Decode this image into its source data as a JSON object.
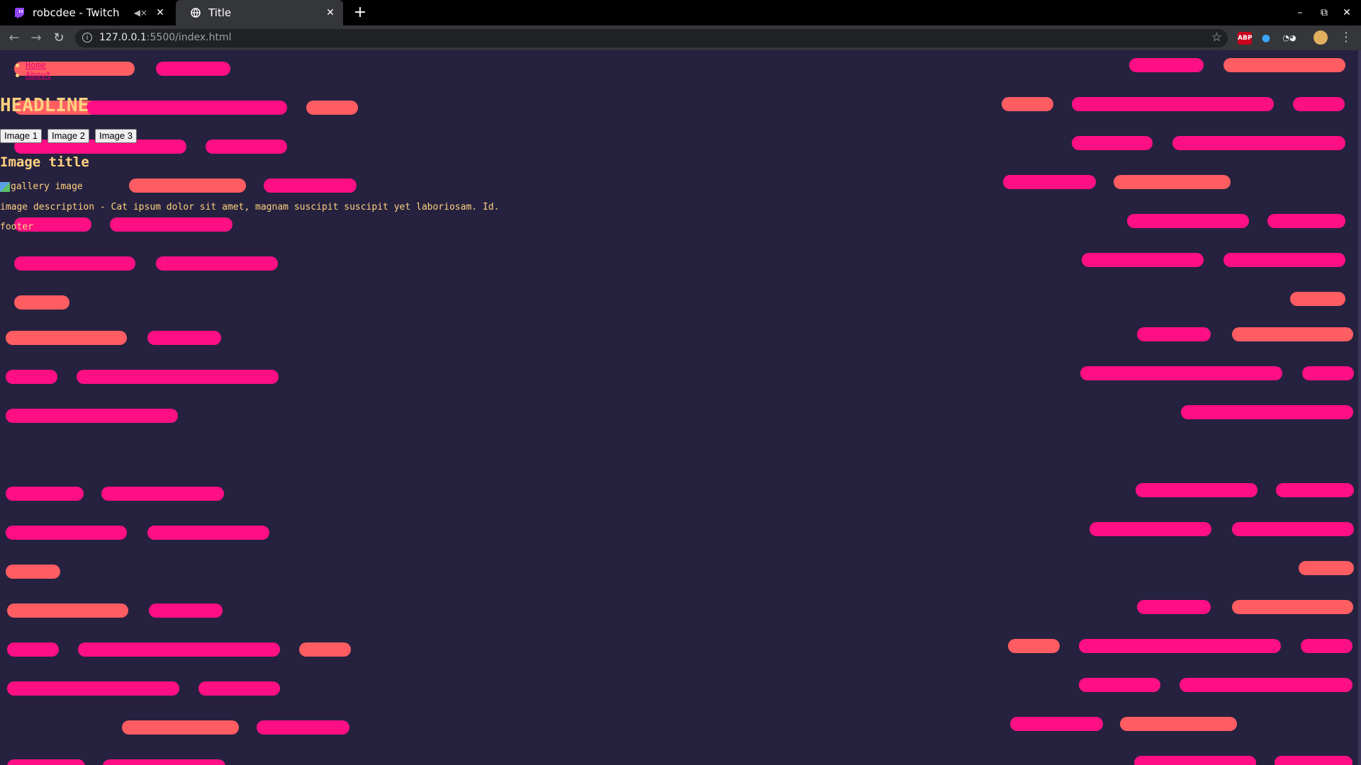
{
  "browser": {
    "tabs": [
      {
        "title": "robcdee - Twitch",
        "active": false,
        "favicon": "twitch-icon",
        "audio": "muted-speaker-icon"
      },
      {
        "title": "Title",
        "active": true,
        "favicon": "globe-icon"
      }
    ],
    "new_tab": "+",
    "window_controls": {
      "minimize": "–",
      "maximize": "⧉",
      "close": "✕"
    },
    "url_host": "127.0.0.1",
    "url_path": ":5500/index.html",
    "extensions": {
      "abp_label": "ABP"
    }
  },
  "page": {
    "nav": [
      "Home",
      "About"
    ],
    "headline": "HEADLINE",
    "image_buttons": [
      "Image 1",
      "Image 2",
      "Image 3"
    ],
    "image_title": "Image title",
    "image_alt": "gallery image",
    "image_description": "image description - Cat ipsum dolor sit amet, magnam suscipit suscipit yet laboriosam. Id.",
    "footer": "footer"
  },
  "colors": {
    "background": "#26213f",
    "text": "#ffd27f",
    "link": "#e6007a",
    "pill_pink": "#ff0f84",
    "pill_coral": "#ff5d62"
  }
}
